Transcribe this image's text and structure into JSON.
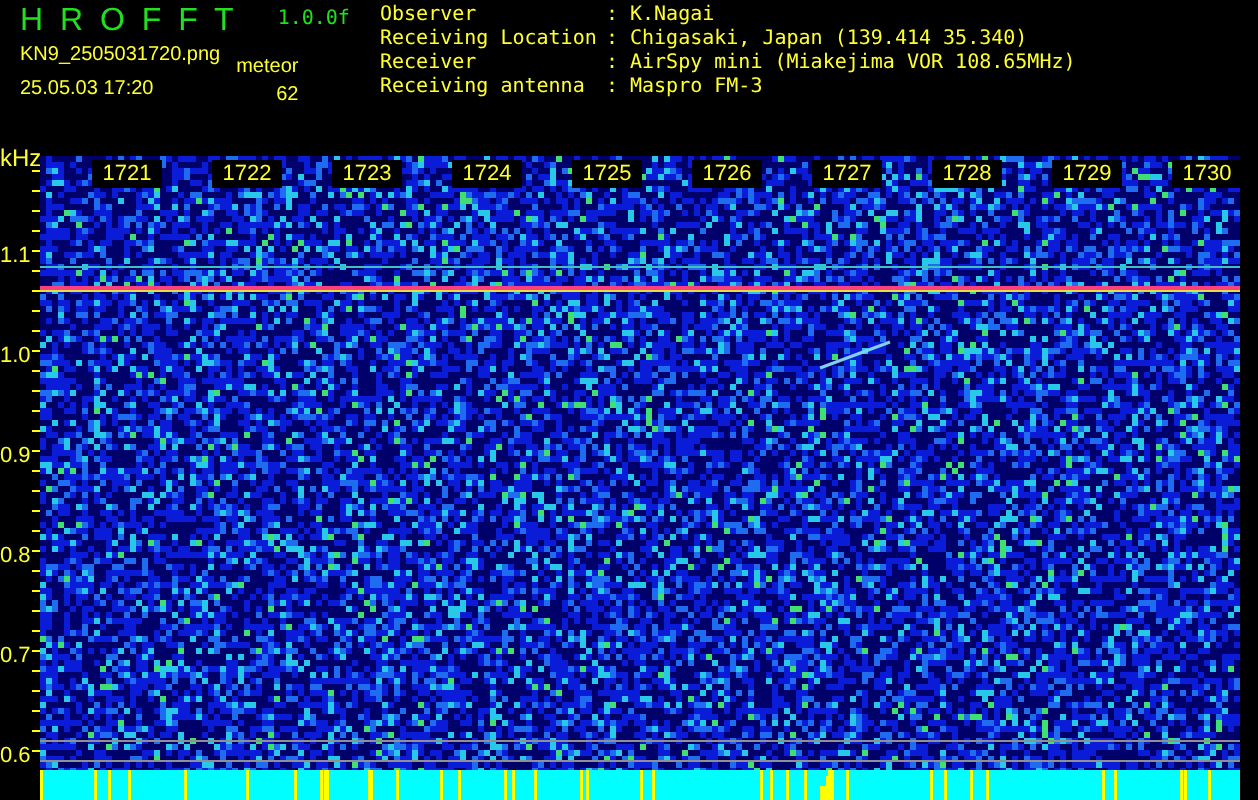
{
  "header": {
    "title": "H R O F F T",
    "version": "1.0.0f",
    "filename": "KN9_2505031720.png",
    "datetime": "25.05.03 17:20",
    "mode": "meteor",
    "count": "62"
  },
  "info": [
    {
      "label": "Observer",
      "sep": ":",
      "value": "K.Nagai"
    },
    {
      "label": "Receiving Location",
      "sep": ":",
      "value": "Chigasaki, Japan (139.414 35.340)"
    },
    {
      "label": "Receiver",
      "sep": ":",
      "value": "AirSpy mini (Miakejima VOR 108.65MHz)"
    },
    {
      "label": "Receiving antenna",
      "sep": ":",
      "value": "Maspro FM-3"
    }
  ],
  "time_labels": [
    "1721",
    "1722",
    "1723",
    "1724",
    "1725",
    "1726",
    "1727",
    "1728",
    "1729",
    "1730"
  ],
  "freq_axis": {
    "unit": "kHz",
    "ticks": [
      "1.1",
      "1.0",
      "0.9",
      "0.8",
      "0.7",
      "0.6"
    ]
  }
}
